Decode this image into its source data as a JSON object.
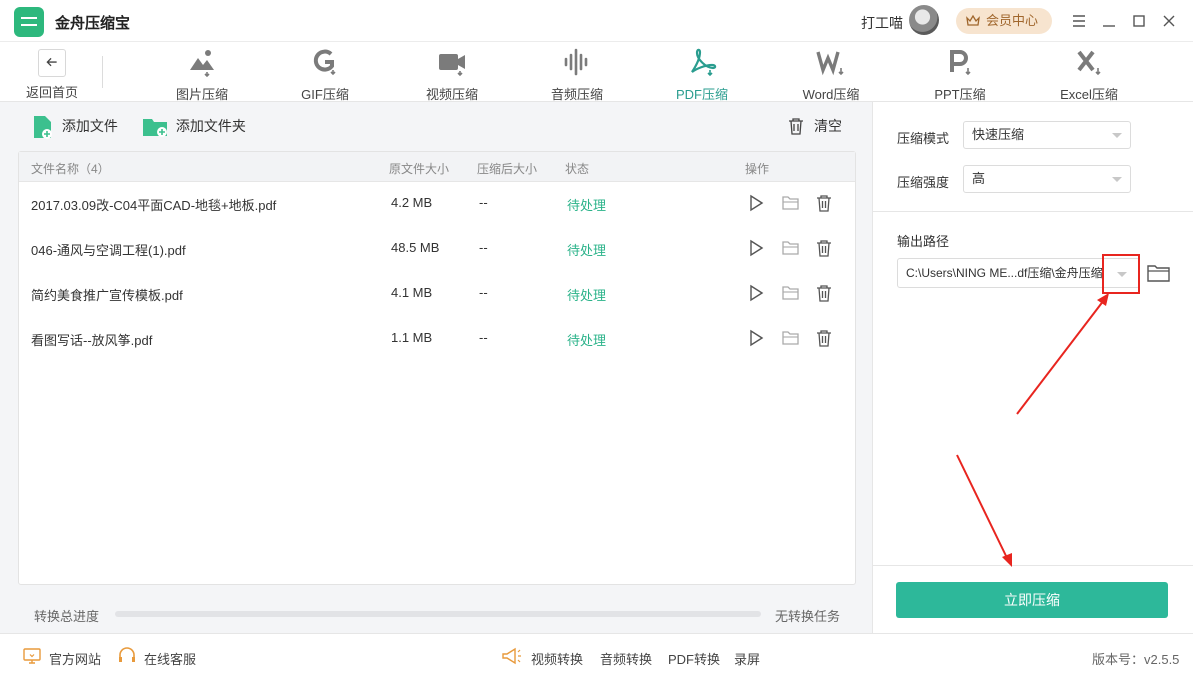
{
  "app": {
    "title": "金舟压缩宝",
    "username": "打工喵",
    "vip_label": "会员中心"
  },
  "toolbar": {
    "back_label": "返回首页",
    "tools": [
      {
        "label": "图片压缩",
        "icon": "image-icon"
      },
      {
        "label": "GIF压缩",
        "icon": "gif-icon"
      },
      {
        "label": "视频压缩",
        "icon": "video-icon"
      },
      {
        "label": "音频压缩",
        "icon": "audio-icon"
      },
      {
        "label": "PDF压缩",
        "icon": "pdf-icon",
        "active": true
      },
      {
        "label": "Word压缩",
        "icon": "word-icon"
      },
      {
        "label": "PPT压缩",
        "icon": "ppt-icon"
      },
      {
        "label": "Excel压缩",
        "icon": "excel-icon"
      }
    ]
  },
  "actions": {
    "add_file": "添加文件",
    "add_folder": "添加文件夹",
    "clear": "清空"
  },
  "table": {
    "headers": {
      "name": "文件名称（4）",
      "original_size": "原文件大小",
      "compressed_size": "压缩后大小",
      "status": "状态",
      "ops": "操作"
    },
    "rows": [
      {
        "name": "2017.03.09改-C04平面CAD-地毯+地板.pdf",
        "size": "4.2 MB",
        "compressed": "--",
        "status": "待处理"
      },
      {
        "name": "046-通风与空调工程(1).pdf",
        "size": "48.5 MB",
        "compressed": "--",
        "status": "待处理"
      },
      {
        "name": "简约美食推广宣传模板.pdf",
        "size": "4.1 MB",
        "compressed": "--",
        "status": "待处理"
      },
      {
        "name": "看图写话--放风筝.pdf",
        "size": "1.1 MB",
        "compressed": "--",
        "status": "待处理"
      }
    ]
  },
  "progress": {
    "label": "转换总进度",
    "status": "无转换任务",
    "fraction": 0
  },
  "settings": {
    "mode_label": "压缩模式",
    "mode_value": "快速压缩",
    "strength_label": "压缩强度",
    "strength_value": "高",
    "output_label": "输出路径",
    "output_path": "C:\\Users\\NING ME...df压缩\\金舟压缩"
  },
  "compress_button": "立即压缩",
  "footer": {
    "website": "官方网站",
    "support": "在线客服",
    "links": [
      "视频转换",
      "音频转换",
      "PDF转换",
      "录屏"
    ],
    "version": "版本号：v2.5.5"
  },
  "colors": {
    "accent": "#2db89a",
    "status": "#2bb38a",
    "active_tab": "#2a9d8f",
    "vip_bg": "#f7e4cf",
    "annotation": "#e8251f"
  }
}
